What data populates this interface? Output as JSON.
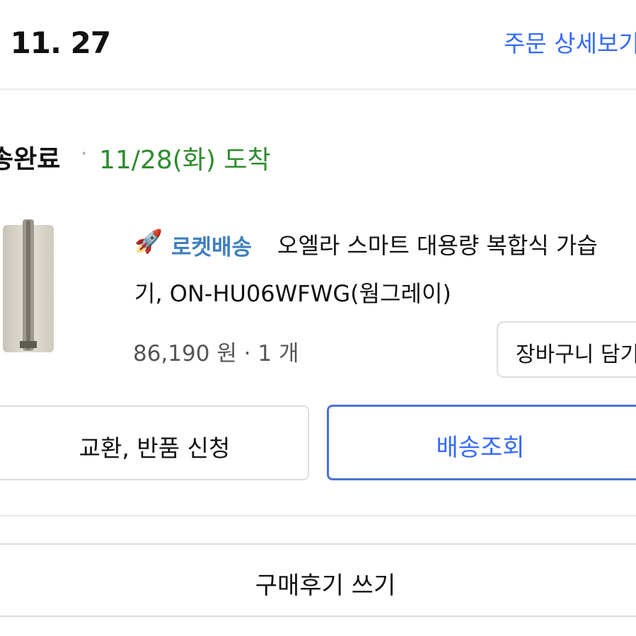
{
  "header": {
    "order_date": ". 11. 27",
    "detail_link": "주문 상세보기"
  },
  "shipment": {
    "status": "송완료",
    "separator": "·",
    "arrival": "11/28(화) 도착"
  },
  "product": {
    "badge_icon": "rocket-icon",
    "badge_label": "로켓배송",
    "name_line1": "오엘라 스마트 대용량 복합식 가습",
    "name_line2": "기, ON-HU06WFWG(웜그레이)",
    "price": "86,190 원 · 1 개",
    "cart_button": "장바구니 담기"
  },
  "actions": {
    "exchange_return": "교환, 반품 신청",
    "tracking": "배송조회",
    "write_review": "구매후기 쓰기"
  },
  "colors": {
    "accent_blue": "#346aff",
    "arrival_green": "#2f8c2f",
    "rocket_blue": "#3f7fbf"
  }
}
